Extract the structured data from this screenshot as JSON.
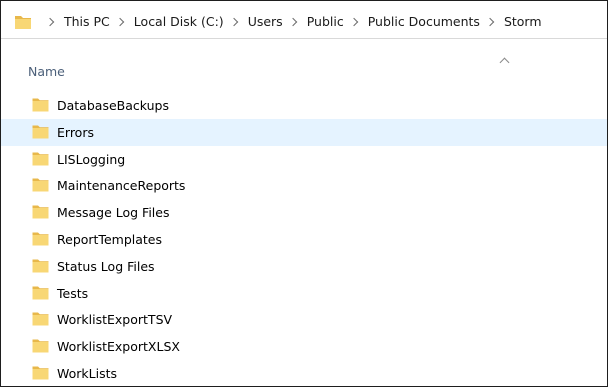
{
  "breadcrumb": [
    "This PC",
    "Local Disk (C:)",
    "Users",
    "Public",
    "Public Documents",
    "Storm"
  ],
  "column": {
    "name": "Name",
    "sort": "ascending"
  },
  "selected_index": 1,
  "folders": [
    "DatabaseBackups",
    "Errors",
    "LISLogging",
    "MaintenanceReports",
    "Message Log Files",
    "ReportTemplates",
    "Status Log Files",
    "Tests",
    "WorklistExportTSV",
    "WorklistExportXLSX",
    "WorkLists"
  ],
  "colors": {
    "folder_fill": "#f8d775",
    "folder_dark": "#e8b84b",
    "selection": "#e5f3ff"
  }
}
